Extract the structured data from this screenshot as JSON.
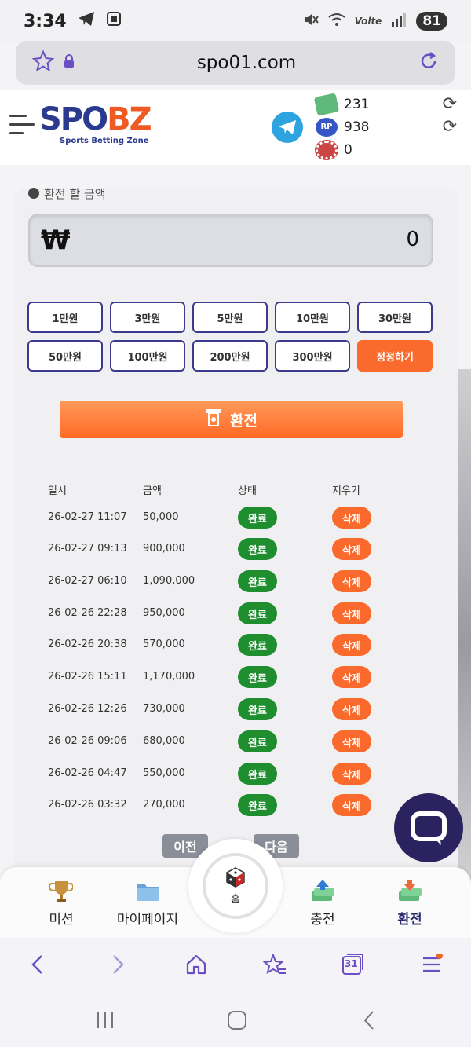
{
  "status_bar": {
    "time": "3:34",
    "battery": "81",
    "network": "Volte"
  },
  "browser": {
    "url": "spo01.com"
  },
  "header": {
    "logo_main_a": "SPO",
    "logo_main_b": "BZ",
    "logo_sub": "Sports Betting Zone",
    "wallet": [
      {
        "icon": "cash-icon",
        "value": "231"
      },
      {
        "icon": "rp-icon",
        "label": "RP",
        "value": "938"
      },
      {
        "icon": "chip-icon",
        "value": "0"
      }
    ]
  },
  "exchange": {
    "label": "환전 할 금액",
    "currency_symbol": "₩",
    "amount": "0",
    "quick_amounts": [
      "1만원",
      "3만원",
      "5만원",
      "10만원",
      "30만원",
      "50만원",
      "100만원",
      "200만원",
      "300만원"
    ],
    "reset_label": "정정하기",
    "submit_label": "환전"
  },
  "history": {
    "headers": {
      "date": "일시",
      "amount": "금액",
      "status": "상태",
      "delete": "지우기"
    },
    "rows": [
      {
        "date": "26-02-27 11:07",
        "amount": "50,000",
        "status": "완료",
        "delete": "삭제"
      },
      {
        "date": "26-02-27 09:13",
        "amount": "900,000",
        "status": "완료",
        "delete": "삭제"
      },
      {
        "date": "26-02-27 06:10",
        "amount": "1,090,000",
        "status": "완료",
        "delete": "삭제"
      },
      {
        "date": "26-02-26 22:28",
        "amount": "950,000",
        "status": "완료",
        "delete": "삭제"
      },
      {
        "date": "26-02-26 20:38",
        "amount": "570,000",
        "status": "완료",
        "delete": "삭제"
      },
      {
        "date": "26-02-26 15:11",
        "amount": "1,170,000",
        "status": "완료",
        "delete": "삭제"
      },
      {
        "date": "26-02-26 12:26",
        "amount": "730,000",
        "status": "완료",
        "delete": "삭제"
      },
      {
        "date": "26-02-26 09:06",
        "amount": "680,000",
        "status": "완료",
        "delete": "삭제"
      },
      {
        "date": "26-02-26 04:47",
        "amount": "550,000",
        "status": "완료",
        "delete": "삭제"
      },
      {
        "date": "26-02-26 03:32",
        "amount": "270,000",
        "status": "완료",
        "delete": "삭제"
      }
    ],
    "prev_label": "이전",
    "next_label": "다음"
  },
  "site_nav": {
    "items": [
      {
        "label": "미션",
        "icon": "trophy-icon"
      },
      {
        "label": "마이페이지",
        "icon": "folder-icon"
      },
      {
        "label": "홈",
        "icon": "dice-icon"
      },
      {
        "label": "충전",
        "icon": "deposit-icon"
      },
      {
        "label": "환전",
        "icon": "withdraw-icon",
        "active": true
      }
    ]
  },
  "browser_nav": {
    "tab_count": "31"
  },
  "colors": {
    "accent_orange": "#fa6a2d",
    "status_green": "#1e8e2e",
    "brand_navy": "#2a3a8f",
    "chip_border": "#3c3a8c"
  }
}
